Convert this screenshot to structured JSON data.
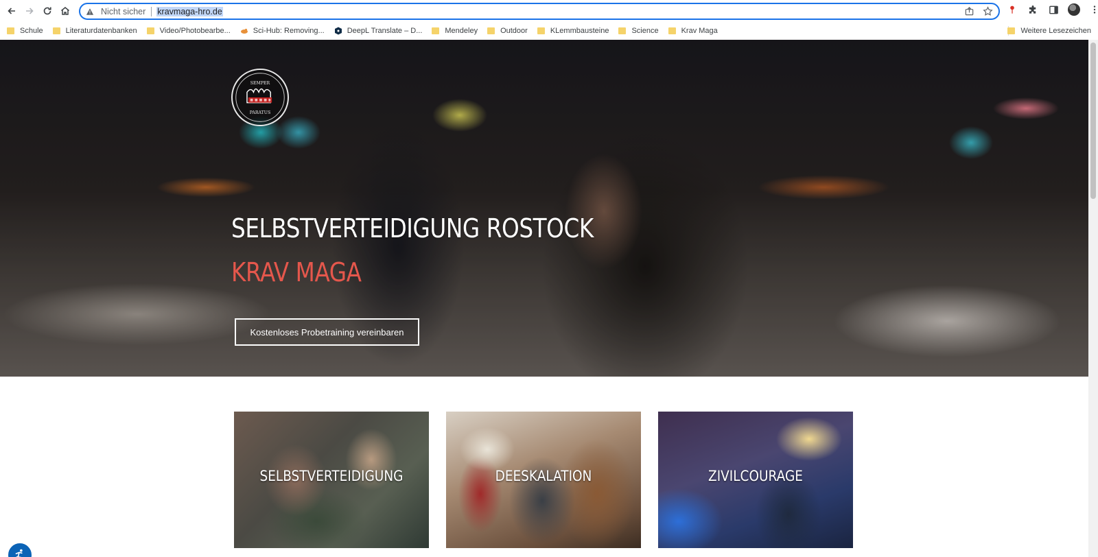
{
  "browser": {
    "address_bar": {
      "security_label": "Nicht sicher",
      "url": "kravmaga-hro.de"
    },
    "bookmarks": [
      {
        "label": "Schule",
        "icon": "folder-icon"
      },
      {
        "label": "Literaturdatenbanken",
        "icon": "folder-icon"
      },
      {
        "label": "Video/Photobearbe...",
        "icon": "folder-icon"
      },
      {
        "label": "Sci-Hub: Removing...",
        "icon": "scihub-icon"
      },
      {
        "label": "DeepL Translate – D...",
        "icon": "deepl-icon"
      },
      {
        "label": "Mendeley",
        "icon": "folder-icon"
      },
      {
        "label": "Outdoor",
        "icon": "folder-icon"
      },
      {
        "label": "KLemmbausteine",
        "icon": "folder-icon"
      },
      {
        "label": "Science",
        "icon": "folder-icon"
      },
      {
        "label": "Krav Maga",
        "icon": "folder-icon"
      }
    ],
    "other_bookmarks": "Weitere Lesezeichen"
  },
  "hero": {
    "logo_text": [
      "SEMPER",
      "PARATUS"
    ],
    "title": "SELBSTVERTEIDIGUNG ROSTOCK",
    "subtitle": "KRAV MAGA",
    "cta_label": "Kostenloses Probetraining vereinbaren"
  },
  "cards": [
    {
      "label": "SELBSTVERTEIDIGUNG"
    },
    {
      "label": "DEESKALATION"
    },
    {
      "label": "ZIVILCOURAGE"
    }
  ],
  "colors": {
    "accent": "#e5574c",
    "omnibox_focus": "#1a73e8",
    "accessibility_button": "#0b63b6"
  }
}
